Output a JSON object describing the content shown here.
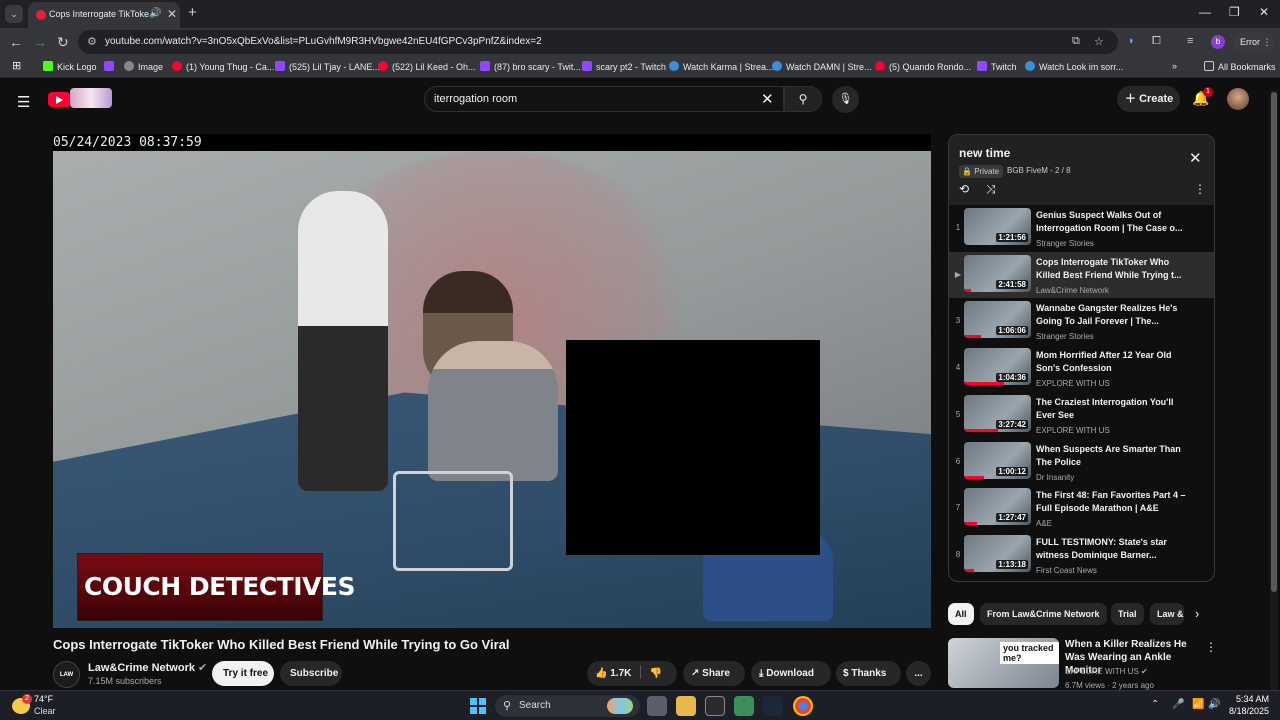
{
  "browser": {
    "tab_title": "Cops Interrogate TikToker W",
    "url": "youtube.com/watch?v=3nO5xQbExVo&list=PLuGvhfM9R3HVbgwe42nEU4fGPCv3pPnfZ&index=2",
    "error_label": "Error",
    "profile_initial": "b",
    "bookmarks": [
      "Kick Logo",
      "Image",
      "(1) Young Thug - Ca...",
      "(525) Lil Tjay - LANE...",
      "(522) Lil Keed - Oh...",
      "(87) bro scary - Twit...",
      "scary pt2 - Twitch",
      "Watch Karma | Strea...",
      "Watch DAMN | Stre...",
      "(5) Quando Rondo...",
      "Twitch",
      "Watch Look im sorr..."
    ],
    "all_bookmarks": "All Bookmarks"
  },
  "youtube": {
    "search_query": "iterrogation room",
    "create_label": "Create",
    "notif_count": "1"
  },
  "video": {
    "timestamp": "05/24/2023 08:37:59",
    "watermark": "COUCH DETECTIVES",
    "title": "Cops Interrogate TikToker Who Killed Best Friend While Trying to Go Viral",
    "channel": "Law&Crime Network",
    "channel_logo_text": "LAW CRIME",
    "subscribers": "7.15M subscribers",
    "try_free": "Try it free",
    "subscribe": "Subscribe",
    "likes": "1.7K",
    "share": "Share",
    "download": "Download",
    "thanks": "Thanks",
    "more": "..."
  },
  "playlist": {
    "title": "new time",
    "privacy": "Private",
    "owner_position": "BGB FiveM - 2 / 8",
    "items": [
      {
        "index": "1",
        "title": "Genius Suspect Walks Out of Interrogation Room | The Case o...",
        "channel": "Stranger Stories",
        "duration": "1:21:56",
        "progress": 0
      },
      {
        "index": "▶",
        "title": "Cops Interrogate TikToker Who Killed Best Friend While Trying t...",
        "channel": "Law&Crime Network",
        "duration": "2:41:58",
        "progress": 0.1
      },
      {
        "index": "3",
        "title": "Wannabe Gangster Realizes He's Going To Jail Forever | The...",
        "channel": "Stranger Stories",
        "duration": "1:06:06",
        "progress": 0.25
      },
      {
        "index": "4",
        "title": "Mom Horrified After 12 Year Old Son's Confession",
        "channel": "EXPLORE WITH US",
        "duration": "1:04:36",
        "progress": 0.6
      },
      {
        "index": "5",
        "title": "The Craziest Interrogation You'll Ever See",
        "channel": "EXPLORE WITH US",
        "duration": "3:27:42",
        "progress": 0.5
      },
      {
        "index": "6",
        "title": "When Suspects Are Smarter Than The Police",
        "channel": "Dr Insanity",
        "duration": "1:00:12",
        "progress": 0.3
      },
      {
        "index": "7",
        "title": "The First 48: Fan Favorites Part 4 – Full Episode Marathon | A&E",
        "channel": "A&E",
        "duration": "1:27:47",
        "progress": 0.2
      },
      {
        "index": "8",
        "title": "FULL TESTIMONY: State's star witness Dominique Barner...",
        "channel": "First Coast News",
        "duration": "1:13:18",
        "progress": 0.15
      }
    ]
  },
  "chips": [
    "All",
    "From Law&Crime Network",
    "Trial",
    "Law & Order"
  ],
  "recommendation": {
    "title": "When a Killer Realizes He Was Wearing an Ankle Monitor",
    "channel": "EXPLORE WITH US",
    "meta": "6.7M views · 2 years ago",
    "thumb_text": "you tracked me?"
  },
  "taskbar": {
    "temp": "74°F",
    "condition": "Clear",
    "weather_badge": "2",
    "search": "Search",
    "time": "5:34 AM",
    "date": "8/18/2025"
  }
}
